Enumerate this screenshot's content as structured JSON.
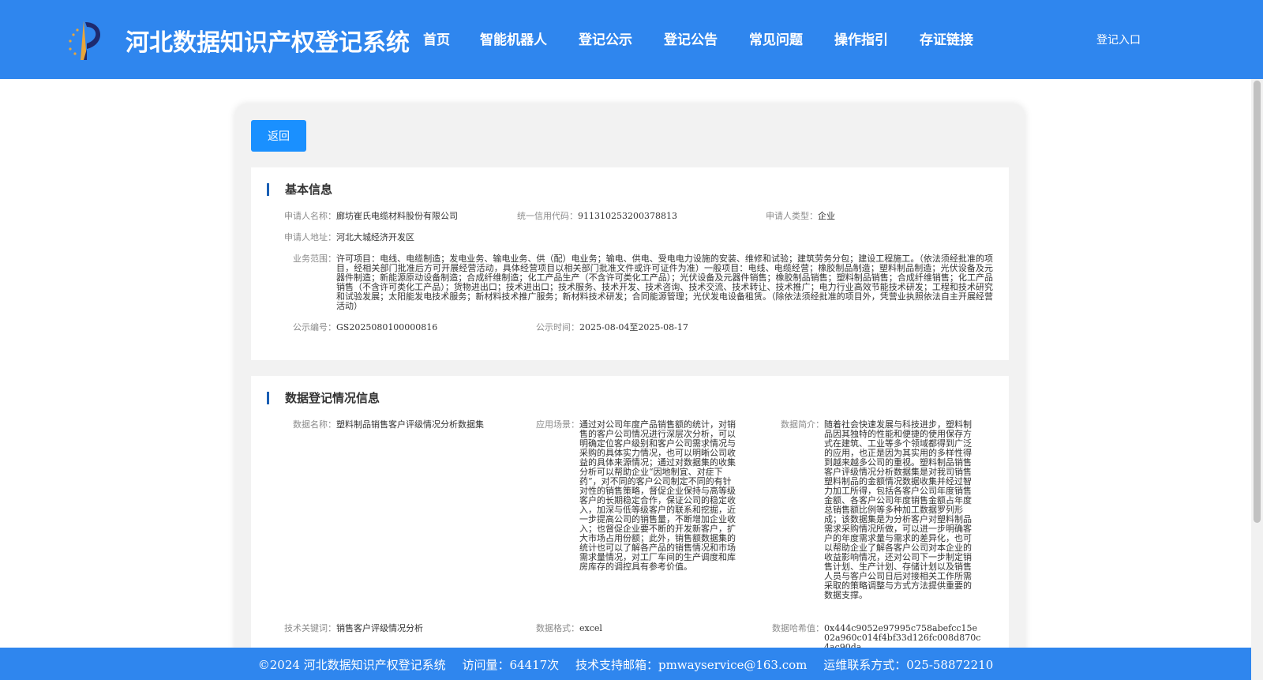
{
  "header": {
    "site_title": "河北数据知识产权登记系统",
    "logo_icon": "emblem-logo-icon",
    "nav": [
      "首页",
      "智能机器人",
      "登记公示",
      "登记公告",
      "常见问题",
      "操作指引",
      "存证链接"
    ],
    "login_label": "登记入口",
    "bg_color": "#2f86ee"
  },
  "back_label": "返回",
  "basic": {
    "title": "基本信息",
    "applicant_name_label": "申请人名称：",
    "applicant_name": "廊坊崔氏电缆材料股份有限公司",
    "credit_code_label": "统一信用代码：",
    "credit_code": "911310253200378813",
    "type_label": "申请人类型：",
    "type": "企业",
    "address_label": "申请人地址：",
    "address": "河北大城经济开发区",
    "scope_label": "业务范围：",
    "scope": "许可项目：电线、电缆制造；发电业务、输电业务、供（配）电业务；输电、供电、受电电力设施的安装、维修和试验；建筑劳务分包；建设工程施工。（依法须经批准的项目，经相关部门批准后方可开展经营活动，具体经营项目以相关部门批准文件或许可证件为准）一般项目：电线、电缆经营；橡胶制品制造；塑料制品制造；光伏设备及元器件制造；新能源原动设备制造；合成纤维制造；化工产品生产（不含许可类化工产品）；光伏设备及元器件销售；橡胶制品销售；塑料制品销售；合成纤维销售；化工产品销售（不含许可类化工产品）；货物进出口；技术进出口；技术服务、技术开发、技术咨询、技术交流、技术转让、技术推广；电力行业高效节能技术研发；工程和技术研究和试验发展；太阳能发电技术服务；新材料技术推广服务；新材料技术研发；合同能源管理；光伏发电设备租赁。（除依法须经批准的项目外，凭营业执照依法自主开展经营活动）",
    "notice_no_label": "公示编号：",
    "notice_no": "GS2025080100000816",
    "notice_time_label": "公示时间：",
    "notice_time": "2025-08-04至2025-08-17"
  },
  "data_reg": {
    "title": "数据登记情况信息",
    "name_label": "数据名称：",
    "name": "塑料制品销售客户评级情况分析数据集",
    "scene_label": "应用场景：",
    "scene": "通过对公司年度产品销售额的统计，对销售的客户公司情况进行深层次分析，可以明确定位客户级别和客户公司需求情况与采购的具体实力情况，也可以明晰公司收益的具体来源情况；通过对数据集的收集分析可以帮助企业“因地制宜、对症下药”，对不同的客户公司制定不同的有针对性的销售策略，督促企业保持与高等级客户的长期稳定合作，保证公司的稳定收入，加深与低等级客户的联系和挖掘，近一步提高公司的销售量，不断增加企业收入；也督促企业要不断的开发新客户，扩大市场占用份额；此外，销售额数据集的统计也可以了解各产品的销售情况和市场需求量情况，对工厂车间的生产调度和库房库存的调控具有参考价值。",
    "intro_label": "数据简介：",
    "intro": "随着社会快速发展与科技进步，塑料制品因其独特的性能和便捷的使用保存方式在建筑、工业等多个领域都得到广泛的应用，也正是因为其实用的多样性得到越来越多公司的重视。塑料制品销售客户评级情况分析数据集是对我司销售塑料制品的金额情况数据收集并经过智力加工所得，包括各客户公司年度销售金额、各客户公司年度销售金额占年度总销售额比例等多种加工数据罗列形成；该数据集是为分析客户对塑料制品需求采购情况所做，可以进一步明确客户的年度需求量与需求的差异化，也可以帮助企业了解各客户公司对本企业的收益影响情况，还对公司下一步制定销售计划、生产计划、存储计划以及销售人员与客户公司日后对接相关工作所需采取的策略调整与方式方法提供重要的数据支撑。",
    "keyword_label": "技术关键词：",
    "keyword": "销售客户评级情况分析",
    "format_label": "数据格式：",
    "format": "excel",
    "hash_label": "数据哈希值：",
    "hash": "0x444c9052e97995c758abefcc15e02a960c014f4bf33d126fc008d870c4ac90da"
  },
  "footer": {
    "copyright": "©2024 河北数据知识产权登记系统",
    "visits": "访问量：64417次",
    "email": "技术支持邮箱：pmwayservice@163.com",
    "phone": "运维联系方式：025-58872210"
  }
}
